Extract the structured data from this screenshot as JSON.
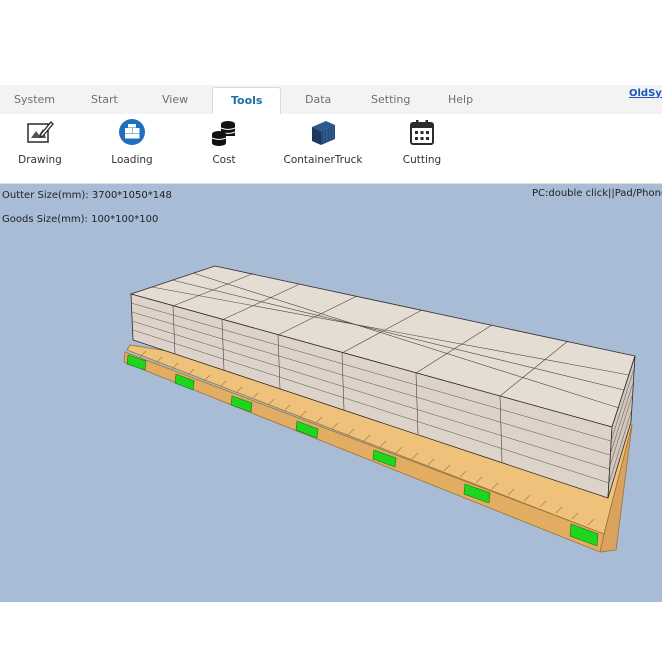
{
  "menu": {
    "tabs": [
      {
        "label": "System"
      },
      {
        "label": "Start"
      },
      {
        "label": "View"
      },
      {
        "label": "Tools"
      },
      {
        "label": "Data"
      },
      {
        "label": "Setting"
      },
      {
        "label": "Help"
      }
    ],
    "active_tab": "Tools",
    "link_label": "OldSys"
  },
  "ribbon": {
    "tools": [
      {
        "label": "Drawing",
        "icon": "drawing-icon"
      },
      {
        "label": "Loading",
        "icon": "loading-icon"
      },
      {
        "label": "Cost",
        "icon": "cost-icon"
      },
      {
        "label": "ContainerTruck",
        "icon": "container-icon"
      },
      {
        "label": "Cutting",
        "icon": "calendar-icon"
      }
    ]
  },
  "viewport": {
    "outer_size": "Outter Size(mm): 3700*1050*148",
    "goods_size": "Goods Size(mm): 100*100*100",
    "hint": "PC:double click||Pad/Phone"
  },
  "colors": {
    "accent": "#1d6fa8",
    "background_3d": "#a8bcd5",
    "box_face": "#e3d9d0",
    "pallet_wood": "#e8b66e",
    "pallet_block": "#1fd61f"
  }
}
